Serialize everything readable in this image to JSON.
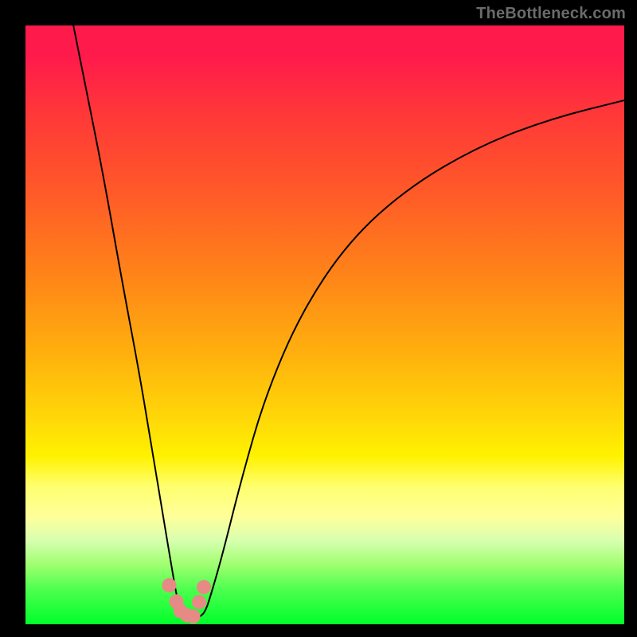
{
  "watermark": "TheBottleneck.com",
  "chart_data": {
    "type": "line",
    "title": "",
    "xlabel": "",
    "ylabel": "",
    "xlim": [
      0,
      100
    ],
    "ylim": [
      0,
      100
    ],
    "series": [
      {
        "name": "left-curve",
        "x": [
          8,
          10,
          13,
          16,
          19,
          21,
          23,
          24.5,
          25.2,
          25.8,
          26,
          26.5,
          27
        ],
        "y": [
          100,
          90,
          75,
          58,
          42,
          30,
          18,
          9,
          5,
          2.5,
          2,
          1.5,
          1.2
        ]
      },
      {
        "name": "right-curve",
        "x": [
          29,
          30,
          31,
          33,
          36,
          40,
          46,
          54,
          64,
          76,
          88,
          100
        ],
        "y": [
          1.2,
          2,
          5,
          12,
          24,
          38,
          52,
          64,
          73,
          80,
          84.5,
          87.5
        ]
      }
    ],
    "markers": [
      {
        "name": "dot-a",
        "x": 24.0,
        "y": 6.5
      },
      {
        "name": "dot-b",
        "x": 25.2,
        "y": 3.8
      },
      {
        "name": "dot-c",
        "x": 25.9,
        "y": 2.2
      },
      {
        "name": "dot-d",
        "x": 27.0,
        "y": 1.5
      },
      {
        "name": "dot-e",
        "x": 28.0,
        "y": 1.3
      },
      {
        "name": "dot-f",
        "x": 29.0,
        "y": 3.7
      },
      {
        "name": "dot-g",
        "x": 29.8,
        "y": 6.2
      }
    ],
    "colors": {
      "curve_stroke": "#000000",
      "marker_fill": "#e78a85",
      "background_border": "#000000"
    }
  }
}
